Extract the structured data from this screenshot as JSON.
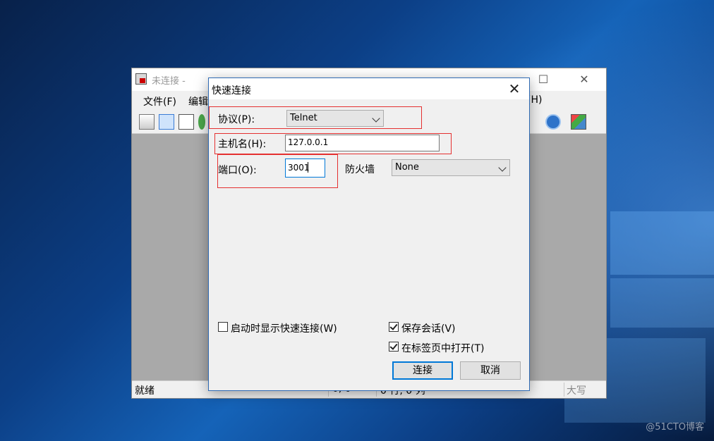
{
  "desktop": {
    "watermark": "@51CTO博客"
  },
  "app": {
    "title": "未连接 -",
    "window_buttons": {
      "minimize": "—",
      "maximize": "☐",
      "close": "✕"
    },
    "menu": [
      "文件(F)",
      "编辑",
      "(H)"
    ],
    "toolbar_icons": [
      "connect-icon",
      "quick-connect-icon",
      "connect-in-tab-icon",
      "reconnect-icon",
      "help-icon",
      "options-icon"
    ],
    "status": {
      "ready": "就绪",
      "pos": "0, 0",
      "rowscols": "0 行, 0 列",
      "caps": "大写"
    }
  },
  "dialog": {
    "title": "快速连接",
    "close": "✕",
    "protocol_label": "协议(P):",
    "protocol_value": "Telnet",
    "hostname_label": "主机名(H):",
    "hostname_value": "127.0.0.1",
    "port_label": "端口(O):",
    "port_value": "3001",
    "firewall_label": "防火墙",
    "firewall_value": "None",
    "show_on_startup": {
      "label": "启动时显示快速连接(W)",
      "checked": false
    },
    "save_session": {
      "label": "保存会话(V)",
      "checked": true
    },
    "open_in_tab": {
      "label": "在标签页中打开(T)",
      "checked": true
    },
    "connect_button": "连接",
    "cancel_button": "取消"
  },
  "colors": {
    "accent": "#0078d7",
    "highlight_box": "#e53030"
  }
}
